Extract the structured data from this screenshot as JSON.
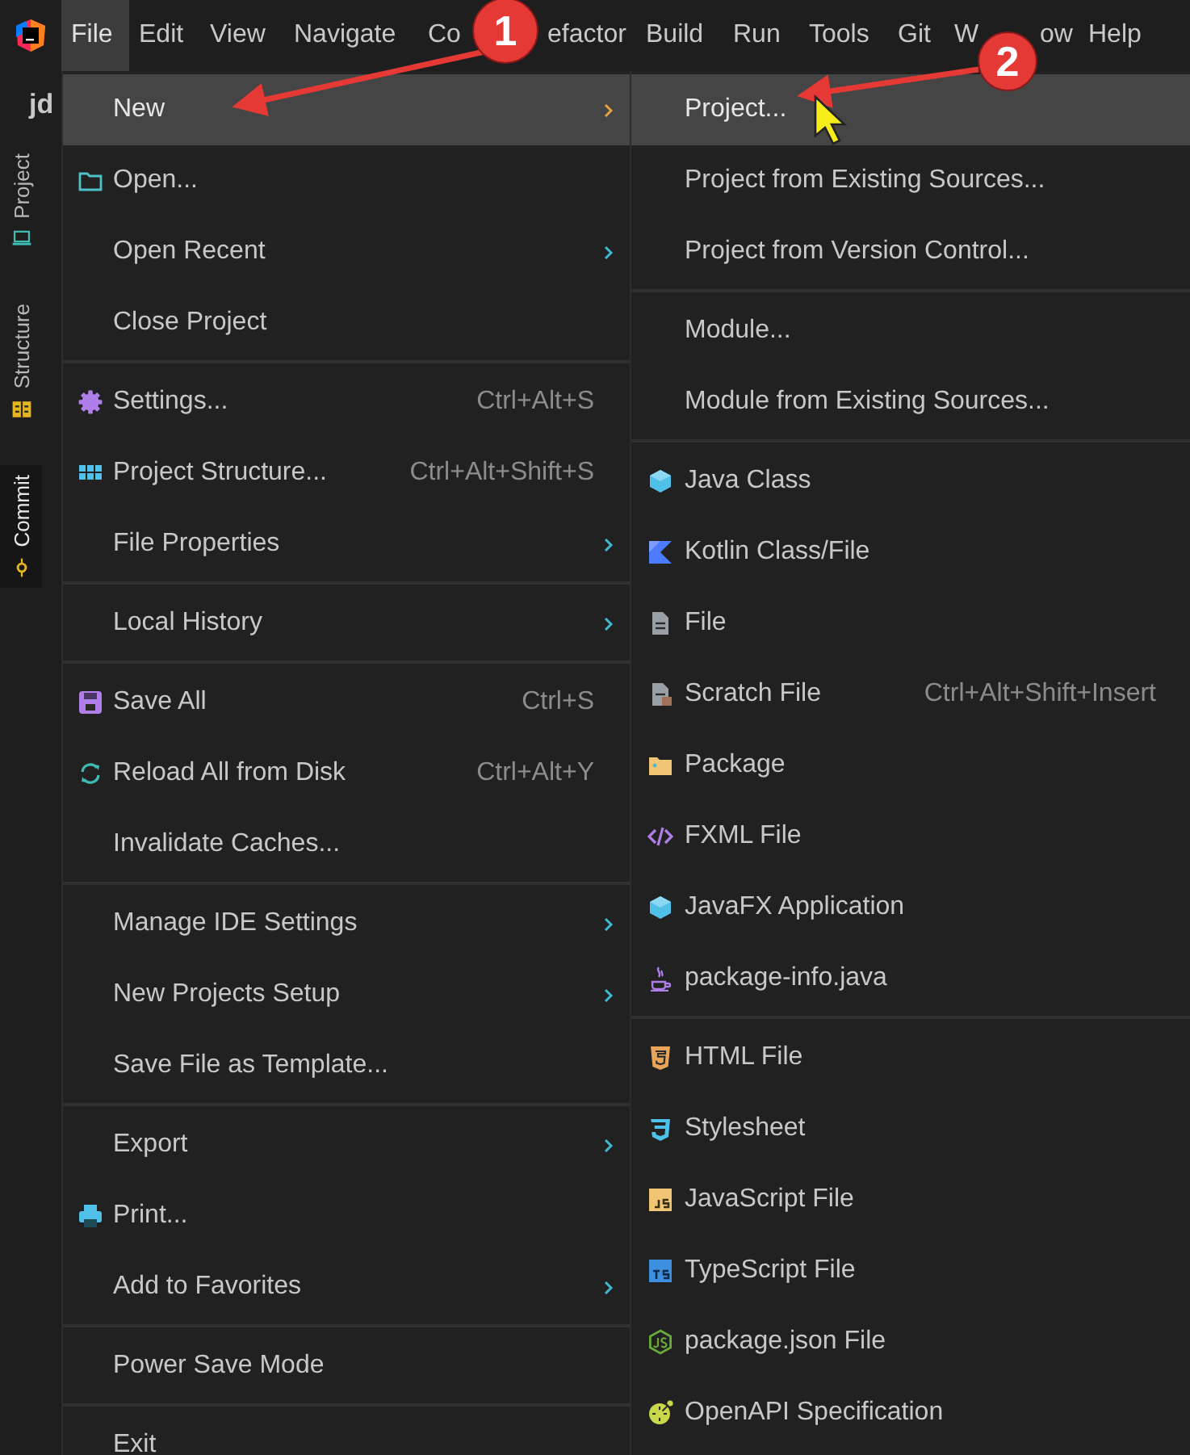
{
  "menu_bar": {
    "items": [
      {
        "label": "File",
        "selected": true
      },
      {
        "label": "Edit",
        "selected": false
      },
      {
        "label": "View",
        "selected": false
      },
      {
        "label": "Navigate",
        "selected": false
      },
      {
        "label": "Co",
        "selected": false
      },
      {
        "label": "efactor",
        "selected": false
      },
      {
        "label": "Build",
        "selected": false
      },
      {
        "label": "Run",
        "selected": false
      },
      {
        "label": "Tools",
        "selected": false
      },
      {
        "label": "Git",
        "selected": false
      },
      {
        "label": "W",
        "selected": false
      },
      {
        "label": "ow",
        "selected": false
      },
      {
        "label": "Help",
        "selected": false
      }
    ]
  },
  "tool_strip": {
    "title": "jd",
    "tabs": [
      {
        "label": "Project",
        "kind": "project",
        "selected": false
      },
      {
        "label": "Structure",
        "kind": "structure",
        "selected": false
      },
      {
        "label": "Commit",
        "kind": "commit",
        "selected": true
      }
    ]
  },
  "file_menu": {
    "groups": [
      [
        {
          "label": "New",
          "kind": "plain",
          "submenu": true,
          "selected": true
        },
        {
          "label": "Open...",
          "kind": "folder",
          "submenu": false,
          "selected": false
        },
        {
          "label": "Open Recent",
          "kind": "plain",
          "submenu": true,
          "selected": false
        },
        {
          "label": "Close Project",
          "kind": "plain",
          "submenu": false,
          "selected": false
        }
      ],
      [
        {
          "label": "Settings...",
          "kind": "gear",
          "shortcut": "Ctrl+Alt+S",
          "submenu": false,
          "selected": false
        },
        {
          "label": "Project Structure...",
          "kind": "grid",
          "shortcut": "Ctrl+Alt+Shift+S",
          "submenu": false,
          "selected": false
        },
        {
          "label": "File Properties",
          "kind": "plain",
          "submenu": true,
          "selected": false
        }
      ],
      [
        {
          "label": "Local History",
          "kind": "plain",
          "submenu": true,
          "selected": false
        }
      ],
      [
        {
          "label": "Save All",
          "kind": "save",
          "shortcut": "Ctrl+S",
          "submenu": false,
          "selected": false
        },
        {
          "label": "Reload All from Disk",
          "kind": "reload",
          "shortcut": "Ctrl+Alt+Y",
          "submenu": false,
          "selected": false
        },
        {
          "label": "Invalidate Caches...",
          "kind": "plain",
          "submenu": false,
          "selected": false
        }
      ],
      [
        {
          "label": "Manage IDE Settings",
          "kind": "plain",
          "submenu": true,
          "selected": false
        },
        {
          "label": "New Projects Setup",
          "kind": "plain",
          "submenu": true,
          "selected": false
        },
        {
          "label": "Save File as Template...",
          "kind": "plain",
          "submenu": false,
          "selected": false
        }
      ],
      [
        {
          "label": "Export",
          "kind": "plain",
          "submenu": true,
          "selected": false
        },
        {
          "label": "Print...",
          "kind": "print",
          "submenu": false,
          "selected": false
        },
        {
          "label": "Add to Favorites",
          "kind": "plain",
          "submenu": true,
          "selected": false
        }
      ],
      [
        {
          "label": "Power Save Mode",
          "kind": "plain",
          "submenu": false,
          "selected": false
        }
      ],
      [
        {
          "label": "Exit",
          "kind": "plain",
          "submenu": false,
          "selected": false
        }
      ]
    ]
  },
  "new_submenu": {
    "groups": [
      [
        {
          "label": "Project...",
          "kind": "plain",
          "submenu": false,
          "selected": true
        },
        {
          "label": "Project from Existing Sources...",
          "kind": "plain",
          "submenu": false,
          "selected": false
        },
        {
          "label": "Project from Version Control...",
          "kind": "plain",
          "submenu": false,
          "selected": false
        }
      ],
      [
        {
          "label": "Module...",
          "kind": "plain",
          "submenu": false,
          "selected": false
        },
        {
          "label": "Module from Existing Sources...",
          "kind": "plain",
          "submenu": false,
          "selected": false
        }
      ],
      [
        {
          "label": "Java Class",
          "kind": "class",
          "submenu": false,
          "selected": false
        },
        {
          "label": "Kotlin Class/File",
          "kind": "kotlin",
          "submenu": false,
          "selected": false
        },
        {
          "label": "File",
          "kind": "file",
          "submenu": false,
          "selected": false
        },
        {
          "label": "Scratch File",
          "kind": "scratch",
          "shortcut": "Ctrl+Alt+Shift+Insert",
          "submenu": false,
          "selected": false
        },
        {
          "label": "Package",
          "kind": "package",
          "submenu": false,
          "selected": false
        },
        {
          "label": "FXML File",
          "kind": "fxml",
          "submenu": false,
          "selected": false
        },
        {
          "label": "JavaFX Application",
          "kind": "class",
          "submenu": false,
          "selected": false
        },
        {
          "label": "package-info.java",
          "kind": "java",
          "submenu": false,
          "selected": false
        }
      ],
      [
        {
          "label": "HTML File",
          "kind": "html",
          "submenu": false,
          "selected": false
        },
        {
          "label": "Stylesheet",
          "kind": "css",
          "submenu": false,
          "selected": false
        },
        {
          "label": "JavaScript File",
          "kind": "js",
          "submenu": false,
          "selected": false
        },
        {
          "label": "TypeScript File",
          "kind": "ts",
          "submenu": false,
          "selected": false
        },
        {
          "label": "package.json File",
          "kind": "node",
          "submenu": false,
          "selected": false
        },
        {
          "label": "OpenAPI Specification",
          "kind": "openapi",
          "submenu": false,
          "selected": false
        }
      ]
    ]
  },
  "annotations": {
    "callouts": [
      {
        "number": "1"
      },
      {
        "number": "2"
      }
    ]
  }
}
